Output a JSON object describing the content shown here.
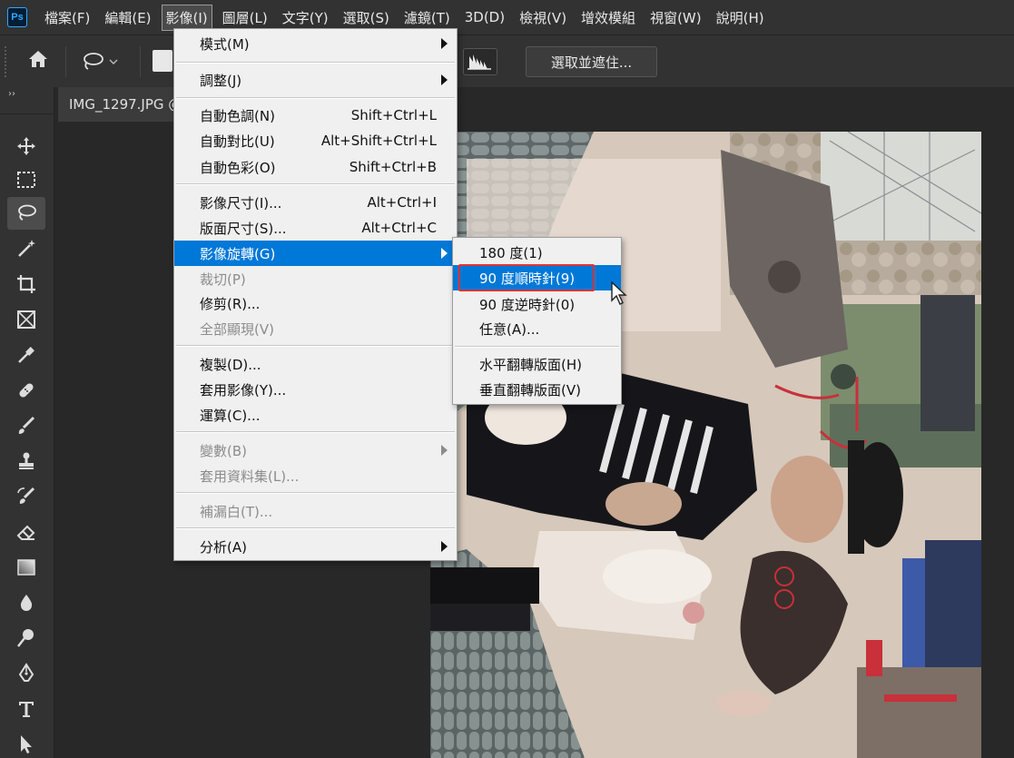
{
  "app": {
    "logo": "Ps",
    "colors": {
      "menu_highlight": "#0078d7",
      "annotation_red": "#e23232"
    }
  },
  "menubar": {
    "items": [
      {
        "label": "檔案(F)"
      },
      {
        "label": "編輯(E)"
      },
      {
        "label": "影像(I)",
        "active": true
      },
      {
        "label": "圖層(L)"
      },
      {
        "label": "文字(Y)"
      },
      {
        "label": "選取(S)"
      },
      {
        "label": "濾鏡(T)"
      },
      {
        "label": "3D(D)"
      },
      {
        "label": "檢視(V)"
      },
      {
        "label": "增效模組"
      },
      {
        "label": "視窗(W)"
      },
      {
        "label": "說明(H)"
      }
    ]
  },
  "options": {
    "select_mask_label": "選取並遮住..."
  },
  "toolbar": {
    "collapse_glyph": "››"
  },
  "tabs": {
    "document": "IMG_1297.JPG @"
  },
  "image_menu": {
    "items": [
      {
        "label": "模式(M)",
        "shortcut": "",
        "submenu": true
      },
      {
        "label": "調整(J)",
        "shortcut": "",
        "submenu": true
      },
      {
        "label": "自動色調(N)",
        "shortcut": "Shift+Ctrl+L"
      },
      {
        "label": "自動對比(U)",
        "shortcut": "Alt+Shift+Ctrl+L"
      },
      {
        "label": "自動色彩(O)",
        "shortcut": "Shift+Ctrl+B"
      },
      {
        "label": "影像尺寸(I)...",
        "shortcut": "Alt+Ctrl+I"
      },
      {
        "label": "版面尺寸(S)...",
        "shortcut": "Alt+Ctrl+C"
      },
      {
        "label": "影像旋轉(G)",
        "shortcut": "",
        "submenu": true,
        "highlighted": true
      },
      {
        "label": "裁切(P)",
        "shortcut": "",
        "disabled": true
      },
      {
        "label": "修剪(R)...",
        "shortcut": ""
      },
      {
        "label": "全部顯現(V)",
        "shortcut": "",
        "disabled": true
      },
      {
        "label": "複製(D)...",
        "shortcut": ""
      },
      {
        "label": "套用影像(Y)...",
        "shortcut": ""
      },
      {
        "label": "運算(C)...",
        "shortcut": ""
      },
      {
        "label": "變數(B)",
        "shortcut": "",
        "submenu": true,
        "disabled": true
      },
      {
        "label": "套用資料集(L)...",
        "shortcut": "",
        "disabled": true
      },
      {
        "label": "補漏白(T)...",
        "shortcut": "",
        "disabled": true
      },
      {
        "label": "分析(A)",
        "shortcut": "",
        "submenu": true
      }
    ]
  },
  "rotate_submenu": {
    "items": [
      {
        "label": "180 度(1)"
      },
      {
        "label": "90 度順時針(9)",
        "highlighted": true
      },
      {
        "label": "90 度逆時針(0)"
      },
      {
        "label": "任意(A)..."
      },
      {
        "label": "水平翻轉版面(H)"
      },
      {
        "label": "垂直翻轉版面(V)"
      }
    ]
  }
}
